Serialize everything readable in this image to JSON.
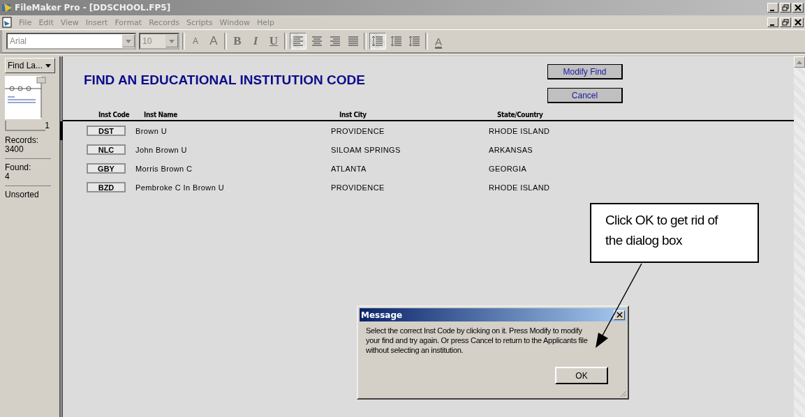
{
  "window": {
    "title": "FileMaker Pro - [DDSCHOOL.FP5]"
  },
  "menu": [
    "File",
    "Edit",
    "View",
    "Insert",
    "Format",
    "Records",
    "Scripts",
    "Window",
    "Help"
  ],
  "toolbar": {
    "font": "Arial",
    "size": "10",
    "buttons": [
      {
        "kind": "shrink",
        "label": "A"
      },
      {
        "kind": "grow",
        "label": "A"
      },
      {
        "kind": "bold",
        "label": "B"
      },
      {
        "kind": "italic",
        "label": "I"
      },
      {
        "kind": "underline",
        "label": "U"
      },
      {
        "kind": "align-left",
        "selected": true
      },
      {
        "kind": "align-center",
        "selected": false
      },
      {
        "kind": "align-right",
        "selected": false
      },
      {
        "kind": "justify",
        "selected": false
      },
      {
        "kind": "spacing-single",
        "selected": true
      },
      {
        "kind": "spacing-half",
        "selected": false
      },
      {
        "kind": "spacing-double",
        "selected": false
      },
      {
        "kind": "text-color",
        "label": "A"
      }
    ]
  },
  "status_area": {
    "layout_menu": "Find La...",
    "page": "1",
    "records_label": "Records:",
    "records": "3400",
    "found_label": "Found:",
    "found": "4",
    "sort": "Unsorted"
  },
  "layout": {
    "heading": "FIND AN EDUCATIONAL INSTITUTION CODE",
    "buttons": [
      "Modify Find",
      "Cancel"
    ],
    "columns": [
      "Inst Code",
      "Inst Name",
      "Inst City",
      "State/Country"
    ],
    "rows": [
      {
        "code": "DST",
        "name": "Brown U",
        "city": "PROVIDENCE",
        "state": "RHODE ISLAND",
        "selected": true
      },
      {
        "code": "NLC",
        "name": "John Brown U",
        "city": "SILOAM SPRINGS",
        "state": "ARKANSAS",
        "selected": false
      },
      {
        "code": "GBY",
        "name": "Morris Brown C",
        "city": "ATLANTA",
        "state": "GEORGIA",
        "selected": false
      },
      {
        "code": "BZD",
        "name": "Pembroke C In Brown U",
        "city": "PROVIDENCE",
        "state": "RHODE ISLAND",
        "selected": false
      }
    ]
  },
  "dialog": {
    "title": "Message",
    "text": "Select the correct Inst Code by clicking on it.  Press Modify to modify your find and try again. Or press Cancel to return to the Applicants file without selecting an institution.",
    "button": "OK"
  },
  "callout": {
    "text": "Click OK to get rid of the dialog box"
  }
}
